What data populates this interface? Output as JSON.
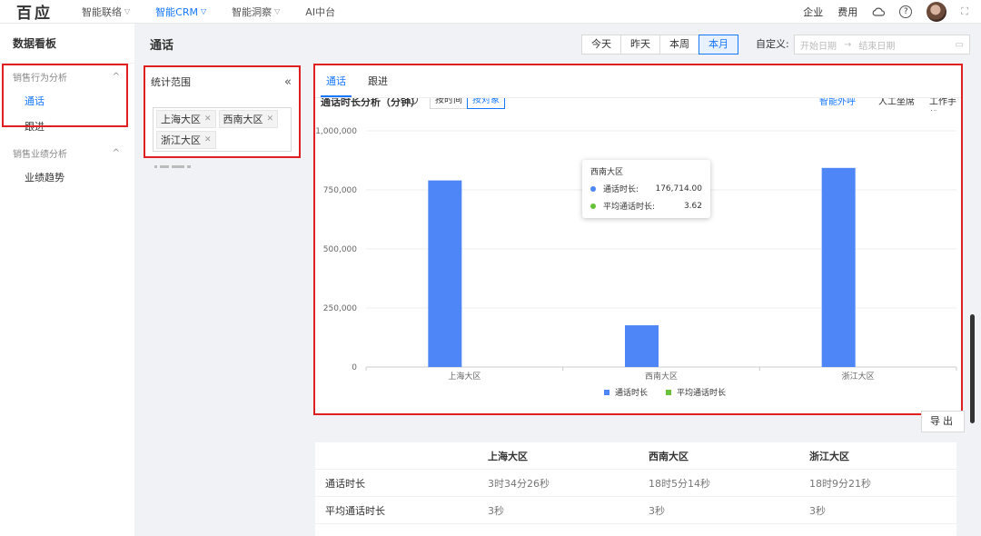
{
  "topbar": {
    "logo": "百应",
    "nav": [
      {
        "label": "智能联络",
        "active": false
      },
      {
        "label": "智能CRM",
        "active": true
      },
      {
        "label": "智能洞察",
        "active": false
      },
      {
        "label": "AI中台",
        "active": false
      }
    ],
    "right": {
      "enterprise": "企业",
      "cost": "费用",
      "help_icon": "?"
    }
  },
  "sidebar": {
    "title": "数据看板",
    "groups": [
      {
        "label": "销售行为分析",
        "items": [
          {
            "label": "通话"
          },
          {
            "label": "跟进"
          }
        ]
      },
      {
        "label": "销售业绩分析",
        "items": [
          {
            "label": "业绩趋势"
          }
        ]
      }
    ]
  },
  "header": {
    "title": "通话",
    "date_tabs": [
      "今天",
      "昨天",
      "本周",
      "本月"
    ],
    "active_date_tab": "本月",
    "custom_label": "自定义:",
    "start_placeholder": "开始日期",
    "range_sep": "→",
    "end_placeholder": "结束日期"
  },
  "scope": {
    "title": "统计范围",
    "collapse": "«",
    "tags": [
      "上海大区",
      "西南大区",
      "浙江大区"
    ]
  },
  "chart_panel": {
    "tabs": [
      "通话",
      "跟进"
    ],
    "active_tab": "通话",
    "sub_title": "通话时长分析（分钟）",
    "seg_time": "按时间",
    "seg_object": "按对象",
    "right_links": [
      "智能外呼",
      "人工坐席",
      "工作手机"
    ]
  },
  "chart_data": {
    "type": "bar",
    "categories": [
      "上海大区",
      "西南大区",
      "浙江大区"
    ],
    "series": [
      {
        "name": "通话时长",
        "values": [
          790000,
          176714,
          843000
        ],
        "color": "#4e86f7"
      },
      {
        "name": "平均通话时长",
        "values": [
          3,
          3.62,
          3
        ],
        "color": "#67c23a"
      }
    ],
    "yticks": [
      "0",
      "250,000",
      "500,000",
      "750,000",
      "1,000,000"
    ],
    "ylim": [
      0,
      1000000
    ],
    "legend": "bottom",
    "grid": true
  },
  "tooltip": {
    "title": "西南大区",
    "rows": [
      {
        "label": "通话时长:",
        "value": "176,714.00",
        "color": "#4e86f7"
      },
      {
        "label": "平均通话时长:",
        "value": "3.62",
        "color": "#67c23a"
      }
    ]
  },
  "export_label": "导出",
  "table": {
    "headers": [
      "",
      "上海大区",
      "西南大区",
      "浙江大区"
    ],
    "rows": [
      [
        "通话时长",
        "3时34分26秒",
        "18时5分14秒",
        "18时9分21秒"
      ],
      [
        "平均通话时长",
        "3秒",
        "3秒",
        "3秒"
      ]
    ]
  }
}
